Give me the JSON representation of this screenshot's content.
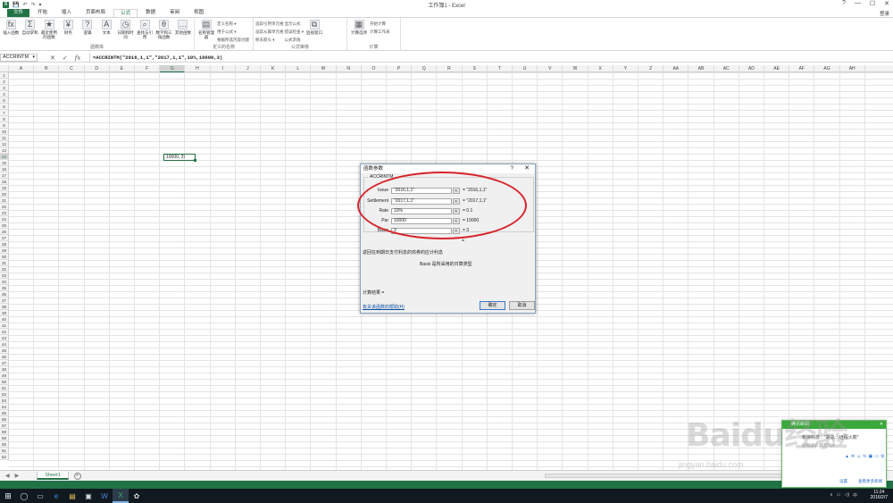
{
  "window": {
    "title": "工作簿1 - Excel",
    "login": "登录",
    "qa_buttons": [
      "💾",
      "↶",
      "↷",
      "▾"
    ],
    "controls": [
      "?",
      "—",
      "☐",
      "✕"
    ]
  },
  "tabs": [
    "文件",
    "开始",
    "插入",
    "页面布局",
    "公式",
    "数据",
    "审阅",
    "视图"
  ],
  "active_tab": "公式",
  "ribbon": {
    "groups": [
      {
        "name": "函数库",
        "big": [
          {
            "icon": "fx",
            "label": "插入函数"
          },
          {
            "icon": "Σ",
            "label": "自动求和"
          },
          {
            "icon": "★",
            "label": "最近使用的函数"
          },
          {
            "icon": "¥",
            "label": "财务"
          },
          {
            "icon": "?",
            "label": "逻辑"
          },
          {
            "icon": "A",
            "label": "文本"
          },
          {
            "icon": "◷",
            "label": "日期和时间"
          },
          {
            "icon": "⌕",
            "label": "查找与引用"
          },
          {
            "icon": "θ",
            "label": "数学和三角函数"
          },
          {
            "icon": "…",
            "label": "其他函数"
          }
        ]
      },
      {
        "name": "定义的名称",
        "big": [
          {
            "icon": "▤",
            "label": "名称管理器"
          }
        ],
        "small": [
          "定义名称 ▾",
          "用于公式 ▾",
          "根据所选内容创建"
        ]
      },
      {
        "name": "公式审核",
        "small": [
          "追踪引用单元格",
          "追踪从属单元格",
          "移去箭头 ▾",
          "显示公式",
          "错误检查 ▾",
          "公式求值"
        ],
        "big": [
          {
            "icon": "⧉",
            "label": "监视窗口"
          }
        ]
      },
      {
        "name": "计算",
        "big": [
          {
            "icon": "▦",
            "label": "计算选项"
          }
        ],
        "small": [
          "开始计算",
          "计算工作表"
        ]
      }
    ]
  },
  "formula_bar": {
    "name_box": "ACCRINTM",
    "cancel": "✕",
    "enter": "✓",
    "fx": "fx",
    "formula": "=ACCRINTM(\"2016,1,1\",\"2017,1,1\",10%,10000,3)"
  },
  "columns": [
    "A",
    "B",
    "C",
    "D",
    "E",
    "F",
    "G",
    "H",
    "I",
    "J",
    "K",
    "L",
    "M",
    "N",
    "O",
    "P",
    "Q",
    "R",
    "S",
    "T",
    "U",
    "V",
    "W",
    "X",
    "Y",
    "Z",
    "AA",
    "AB",
    "AC",
    "AD",
    "AE",
    "AF",
    "AG",
    "AH"
  ],
  "selected_column": "G",
  "rows": [
    1,
    2,
    3,
    4,
    5,
    6,
    7,
    8,
    9,
    10,
    11,
    12,
    13,
    14,
    15,
    16,
    17,
    18,
    18,
    20,
    21,
    22,
    23,
    24,
    25,
    26,
    27,
    28,
    29,
    30,
    31,
    32,
    33,
    34,
    35,
    36,
    37,
    38,
    39,
    40,
    41,
    42,
    43,
    44,
    45,
    46,
    47,
    48,
    49,
    50,
    51,
    52,
    53,
    54,
    55,
    56,
    57,
    58,
    59,
    60,
    61,
    62
  ],
  "selected_row": 14,
  "active_cell_text": "10000, 3)",
  "dialog": {
    "title": "函数参数",
    "help": "?",
    "close": "✕",
    "function_name": "ACCRINTM",
    "args": [
      {
        "label": "Issue",
        "value": "\"2016,1,1\"",
        "result": "= \"2016,1,1\""
      },
      {
        "label": "Settlement",
        "value": "\"2017,1,1\"",
        "result": "= \"2017,1,1\""
      },
      {
        "label": "Rate",
        "value": "10%",
        "result": "= 0.1"
      },
      {
        "label": "Par",
        "value": "10000",
        "result": "= 10000"
      },
      {
        "label": "Basis",
        "value": "3",
        "result": "= 3"
      }
    ],
    "equals": "=",
    "description": "返回在到期日支付利息的债券的应计利息",
    "arg_desc": "Basis  是所采用的日算类型",
    "calc_result": "计算结果 =",
    "help_link": "有关该函数的帮助(H)",
    "ok": "确定",
    "cancel": "取消"
  },
  "sheets": {
    "tab": "Sheet1",
    "add": "+",
    "nav": [
      "◀",
      "▶"
    ]
  },
  "taskbar": {
    "start": "⊞",
    "items": [
      "◯",
      "▭",
      "e",
      "▤",
      "▣",
      "W",
      "X",
      "✿"
    ],
    "time": "11:24",
    "date": "2016/2/7",
    "tray": [
      "∧",
      "▭",
      "◁)",
      "中"
    ]
  },
  "popup": {
    "header": "腾讯新闻",
    "close": "✕",
    "title": "新浪科技：\"胡总：远程火箭\"",
    "sub": "新闻详情 网友热评",
    "icons": [
      "▲",
      "✉",
      "☺",
      "↻",
      "▣",
      "▭",
      "⚙"
    ],
    "foot_left": "设置",
    "foot_right": "查看更多新闻"
  },
  "watermark": "Baidu经验",
  "watermark_url": "jingyan.baidu.com",
  "accent": "#217346"
}
